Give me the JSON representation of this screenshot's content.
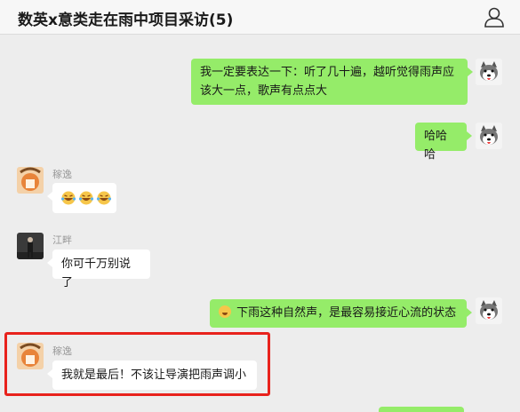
{
  "header": {
    "title": "数英x意类走在雨中项目采访(5)"
  },
  "messages": [
    {
      "side": "out",
      "lines": [
        "我一定要表达一下：听了几十遍，越听觉得雨声应",
        "该大一点，歌声有点点大"
      ]
    },
    {
      "side": "out",
      "text": "哈哈哈"
    },
    {
      "side": "in",
      "sender": "稼逸",
      "emoji": [
        "laughing-crying-emoji",
        "laughing-crying-emoji",
        "laughing-crying-emoji"
      ]
    },
    {
      "side": "in",
      "sender": "江畔",
      "text": "你可千万别说了"
    },
    {
      "side": "out",
      "emoji": "grinning-emoji",
      "text": "下雨这种自然声，是最容易接近心流的状态"
    },
    {
      "side": "in",
      "sender": "稼逸",
      "text": "我就是最后！不该让导演把雨声调小"
    }
  ],
  "colors": {
    "background": "#ededed",
    "outgoing_bubble": "#95ec69",
    "incoming_bubble": "#ffffff",
    "highlight_box": "#e8221c"
  }
}
